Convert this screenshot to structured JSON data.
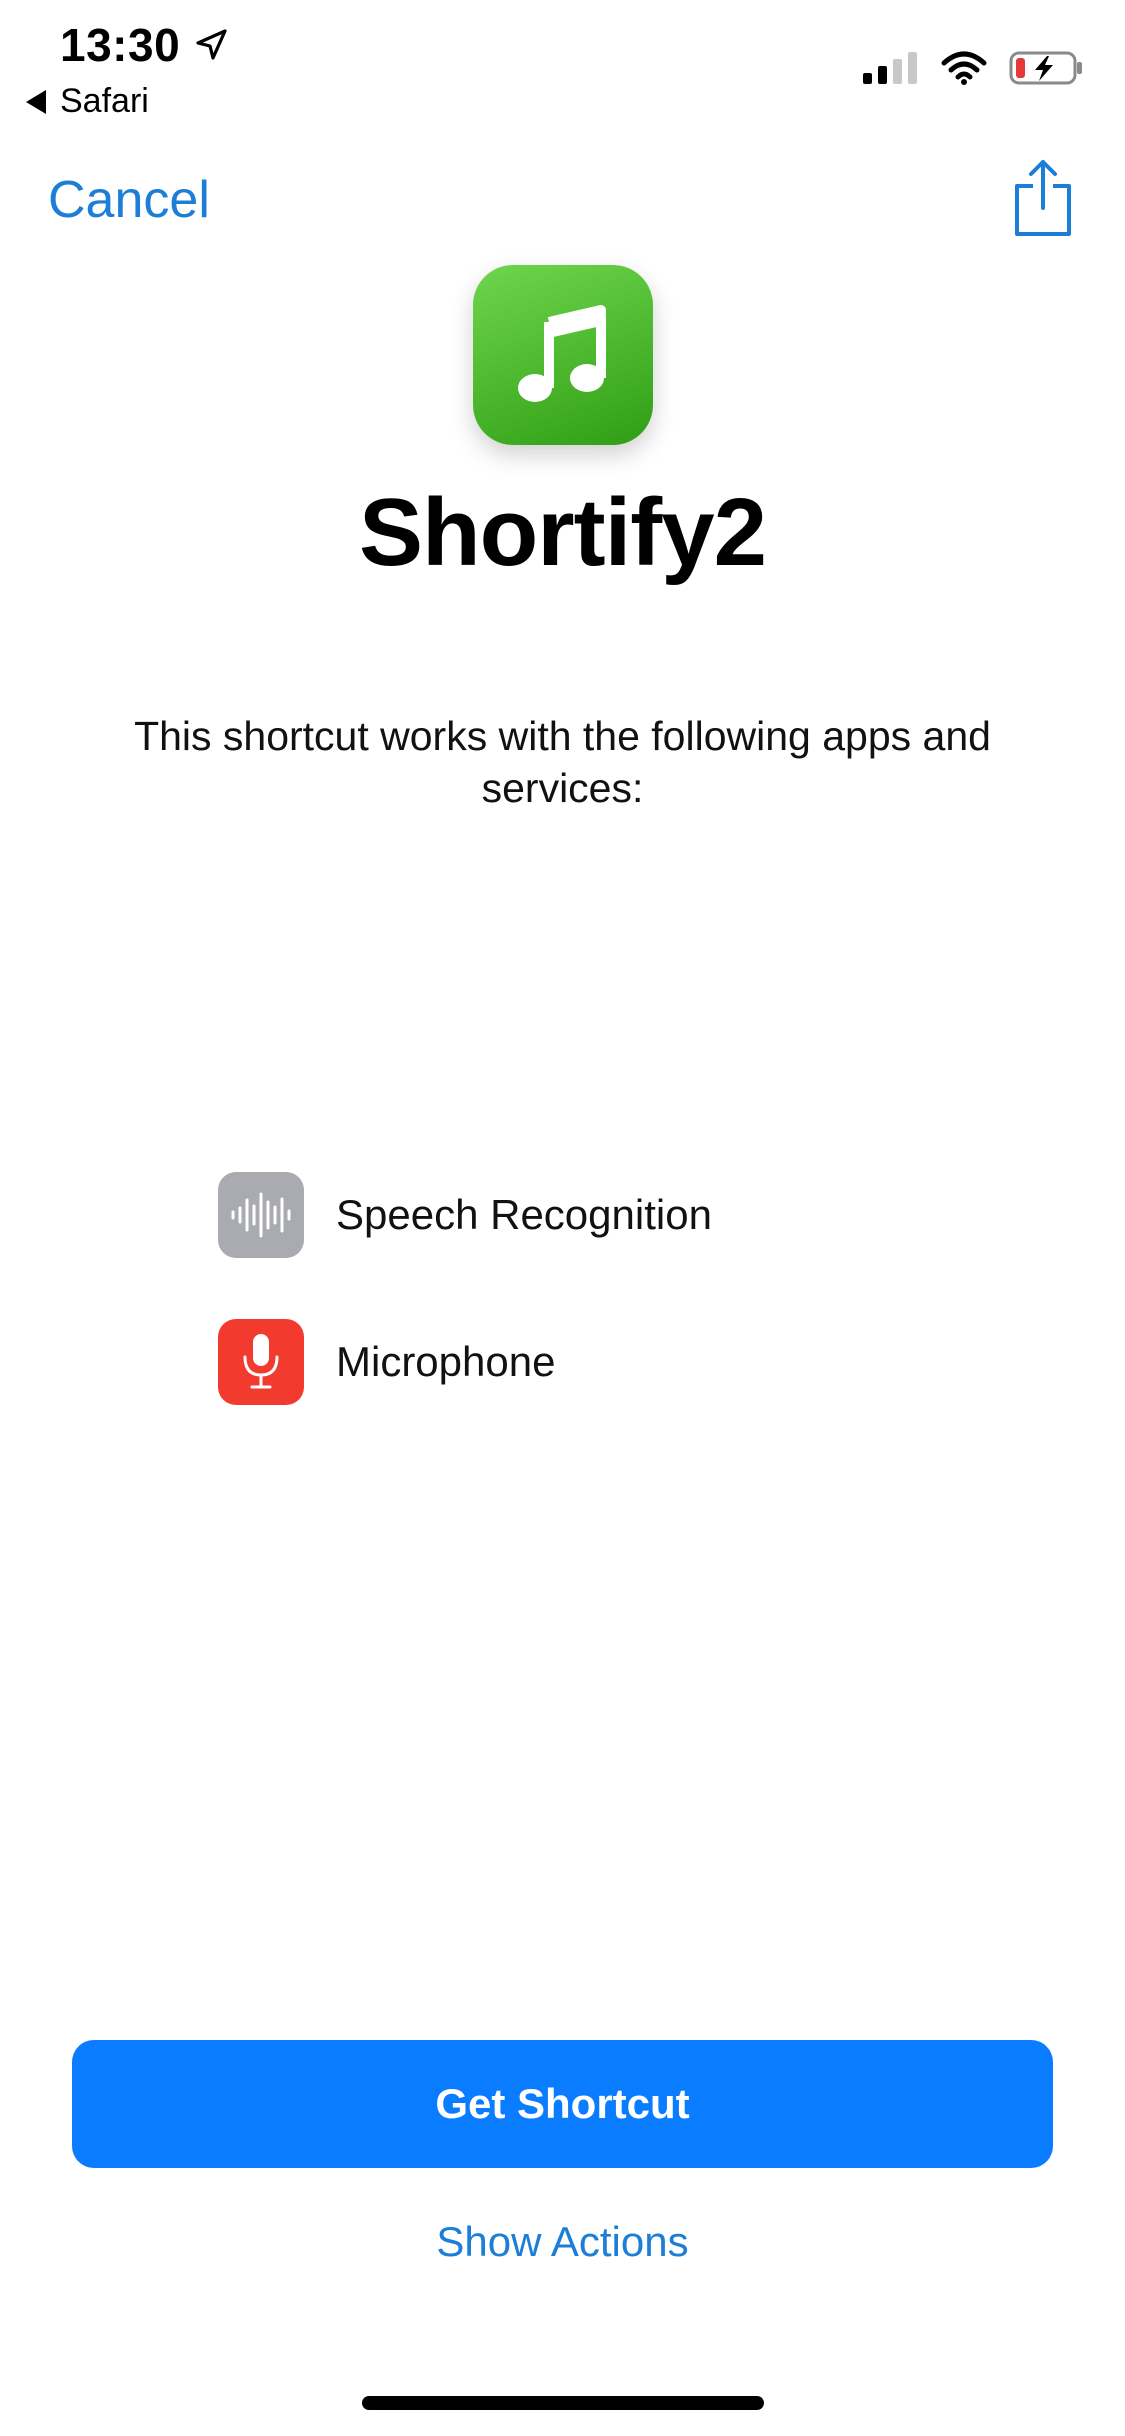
{
  "status_bar": {
    "time": "13:30",
    "back_app": "Safari",
    "battery_color": "#e53935"
  },
  "nav": {
    "cancel_label": "Cancel"
  },
  "shortcut": {
    "name": "Shortify2",
    "icon_color": "#3fb726",
    "icon": "music-note-icon"
  },
  "description": "This shortcut works with the following apps and services:",
  "services": [
    {
      "label": "Speech Recognition",
      "icon": "waveform-icon",
      "color": "#a9abb1"
    },
    {
      "label": "Microphone",
      "icon": "microphone-icon",
      "color": "#f23b2e"
    }
  ],
  "actions": {
    "primary_label": "Get Shortcut",
    "primary_color": "#0a7cff",
    "secondary_label": "Show Actions"
  }
}
